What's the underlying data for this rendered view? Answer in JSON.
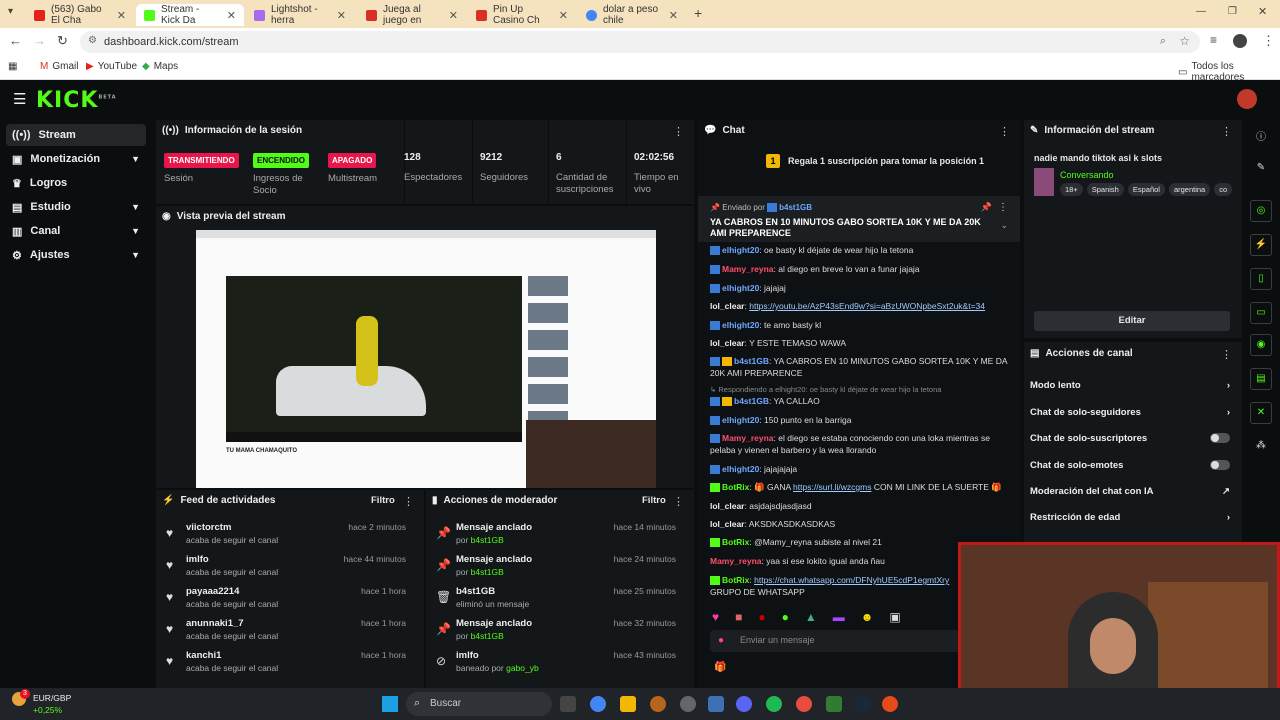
{
  "browser": {
    "tabs": [
      {
        "title": "(563) Gabo El Cha",
        "color": "#e62117"
      },
      {
        "title": "Stream - Kick Da",
        "color": "#53fc18"
      },
      {
        "title": "Lightshot - herra",
        "color": "#a56cf0"
      },
      {
        "title": "Juega al juego en",
        "color": "#d93025"
      },
      {
        "title": "Pin Up Casino Ch",
        "color": "#d93025"
      },
      {
        "title": "dolar a peso chile",
        "color": "#4285f4"
      }
    ],
    "url": "dashboard.kick.com/stream",
    "bookmarks": [
      "Gmail",
      "YouTube",
      "Maps"
    ],
    "all_bookmarks": "Todos los marcadores"
  },
  "kick": {
    "logo": "KICK",
    "beta": "BETA"
  },
  "sidebar": {
    "items": [
      {
        "label": "Stream",
        "icon": "broadcast-icon"
      },
      {
        "label": "Monetización",
        "icon": "money-icon"
      },
      {
        "label": "Logros",
        "icon": "trophy-icon"
      },
      {
        "label": "Estudio",
        "icon": "studio-icon"
      },
      {
        "label": "Canal",
        "icon": "channel-icon"
      },
      {
        "label": "Ajustes",
        "icon": "gear-icon"
      }
    ]
  },
  "session": {
    "title": "Información de la sesión",
    "badges": [
      {
        "badge": "TRANSMITIENDO",
        "label": "Sesión"
      },
      {
        "badge": "ENCENDIDO",
        "label": "Ingresos de Socio"
      },
      {
        "badge": "APAGADO",
        "label": "Multistream"
      }
    ],
    "stats": [
      {
        "value": "128",
        "label": "Espectadores"
      },
      {
        "value": "9212",
        "label": "Seguidores"
      },
      {
        "value": "6",
        "label": "Cantidad de suscripciones"
      },
      {
        "value": "02:02:56",
        "label": "Tiempo en vivo"
      }
    ]
  },
  "preview": {
    "title": "Vista previa del stream",
    "video_caption": "TU MAMA CHAMAQUITO"
  },
  "activity": {
    "title": "Feed de actividades",
    "filter": "Filtro",
    "items": [
      {
        "name": "viictorctm",
        "action": "acaba de seguir el canal",
        "time": "hace 2 minutos"
      },
      {
        "name": "imlfo",
        "action": "acaba de seguir el canal",
        "time": "hace 44 minutos"
      },
      {
        "name": "payaaa2214",
        "action": "acaba de seguir el canal",
        "time": "hace 1 hora"
      },
      {
        "name": "anunnaki1_7",
        "action": "acaba de seguir el canal",
        "time": "hace 1 hora"
      },
      {
        "name": "kanchi1",
        "action": "acaba de seguir el canal",
        "time": "hace 1 hora"
      }
    ]
  },
  "modactions": {
    "title": "Acciones de moderador",
    "filter": "Filtro",
    "items": [
      {
        "title": "Mensaje anclado",
        "prefix": "por",
        "user": "b4st1GB",
        "time": "hace 14 minutos",
        "icon": "pin-icon"
      },
      {
        "title": "Mensaje anclado",
        "prefix": "por",
        "user": "b4st1GB",
        "time": "hace 24 minutos",
        "icon": "pin-icon"
      },
      {
        "title": "b4st1GB",
        "prefix": "eliminó un mensaje",
        "user": "",
        "time": "hace 25 minutos",
        "icon": "trash-icon"
      },
      {
        "title": "Mensaje anclado",
        "prefix": "por",
        "user": "b4st1GB",
        "time": "hace 32 minutos",
        "icon": "pin-icon"
      },
      {
        "title": "imlfo",
        "prefix": "baneado por",
        "user": "gabo_yb",
        "time": "hace 43 minutos",
        "icon": "ban-icon"
      }
    ]
  },
  "chat": {
    "title": "Chat",
    "gift_banner": "Regala 1 suscripción para tomar la posición 1",
    "pinned_by": "Enviado por",
    "pinned_user": "b4st1GB",
    "pinned_text": "YA CABROS EN 10 MINUTOS GABO SORTEA 10K Y ME DA 20K AMI PREPARENCE",
    "messages": [
      {
        "user": "elhight20",
        "color": "#6fa8ff",
        "text": ": oe basty kl déjate de wear hijo la tetona"
      },
      {
        "user": "Mamy_reyna",
        "color": "#ff4d6d",
        "text": ": al diego en breve lo van a funar jajaja"
      },
      {
        "user": "elhight20",
        "color": "#6fa8ff",
        "text": ": jajajaj"
      },
      {
        "user": "lol_clear",
        "color": "#eeeeee",
        "text": ": ",
        "link": "https://youtu.be/AzP43sEnd9w?si=aBzUWONpbeSxt2uk&t=34"
      },
      {
        "user": "elhight20",
        "color": "#6fa8ff",
        "text": ": te amo basty kl"
      },
      {
        "user": "lol_clear",
        "color": "#eeeeee",
        "text": ": Y ESTE TEMASO WAWA"
      },
      {
        "user": "b4st1GB",
        "color": "#6fa8ff",
        "text": ": YA CABROS EN 10 MINUTOS GABO SORTEA 10K Y ME DA 20K AMI PREPARENCE"
      },
      {
        "user": "b4st1GB",
        "color": "#6fa8ff",
        "text": ": YA CALLAO",
        "reply": "Respondiendo a elhight20: oe basty kl déjate de wear hijo la tetona"
      },
      {
        "user": "elhight20",
        "color": "#6fa8ff",
        "text": ": 150 punto en la barriga"
      },
      {
        "user": "Mamy_reyna",
        "color": "#ff4d6d",
        "text": ": el diego se estaba conociendo con una loka mientras se pelaba y vienen el barbero y la wea llorando"
      },
      {
        "user": "elhight20",
        "color": "#6fa8ff",
        "text": ": jajajajaja"
      },
      {
        "user": "BotRix",
        "color": "#53fc18",
        "text": ": 🎁 GANA ",
        "link": "https://surl.li/wzcgms",
        "after": " CON MI LINK DE LA SUERTE 🎁"
      },
      {
        "user": "lol_clear",
        "color": "#eeeeee",
        "text": ": asjdajsdjasdjasd"
      },
      {
        "user": "lol_clear",
        "color": "#eeeeee",
        "text": ": AKSDKASDKASDKAS"
      },
      {
        "user": "BotRix",
        "color": "#53fc18",
        "text": ": @Mamy_reyna subiste al nivel 21"
      },
      {
        "user": "Mamy_reyna",
        "color": "#ff4d6d",
        "text": ": yaa si ese lokito igual anda ñau"
      },
      {
        "user": "BotRix",
        "color": "#53fc18",
        "text": ": ",
        "link": "https://chat.whatsapp.com/DFNyhUE5cdP1egmtXry",
        "after": " GRUPO DE WHATSAPP"
      }
    ],
    "input_placeholder": "Enviar un mensaje"
  },
  "streaminfo": {
    "title": "Información del stream",
    "stream_title": "nadie mando tiktok asi k slots",
    "category": "Conversando",
    "tags": [
      "18+",
      "Spanish",
      "Español",
      "argentina",
      "co"
    ],
    "edit": "Editar"
  },
  "channel_actions": {
    "title": "Acciones de canal",
    "items": [
      {
        "label": "Modo lento",
        "control": "chevron"
      },
      {
        "label": "Chat de solo-seguidores",
        "control": "chevron"
      },
      {
        "label": "Chat de solo-suscriptores",
        "control": "toggle"
      },
      {
        "label": "Chat de solo-emotes",
        "control": "toggle"
      },
      {
        "label": "Moderación del chat con IA",
        "control": "external"
      },
      {
        "label": "Restricción de edad",
        "control": "chevron"
      }
    ]
  },
  "taskbar": {
    "currency": "EUR/GBP",
    "change": "+0,25%",
    "search": "Buscar",
    "notification_count": "3"
  },
  "colors": {
    "accent": "#53fc18",
    "danger": "#e8174b",
    "bg": "#0b0e0f",
    "panel": "#14171a"
  }
}
